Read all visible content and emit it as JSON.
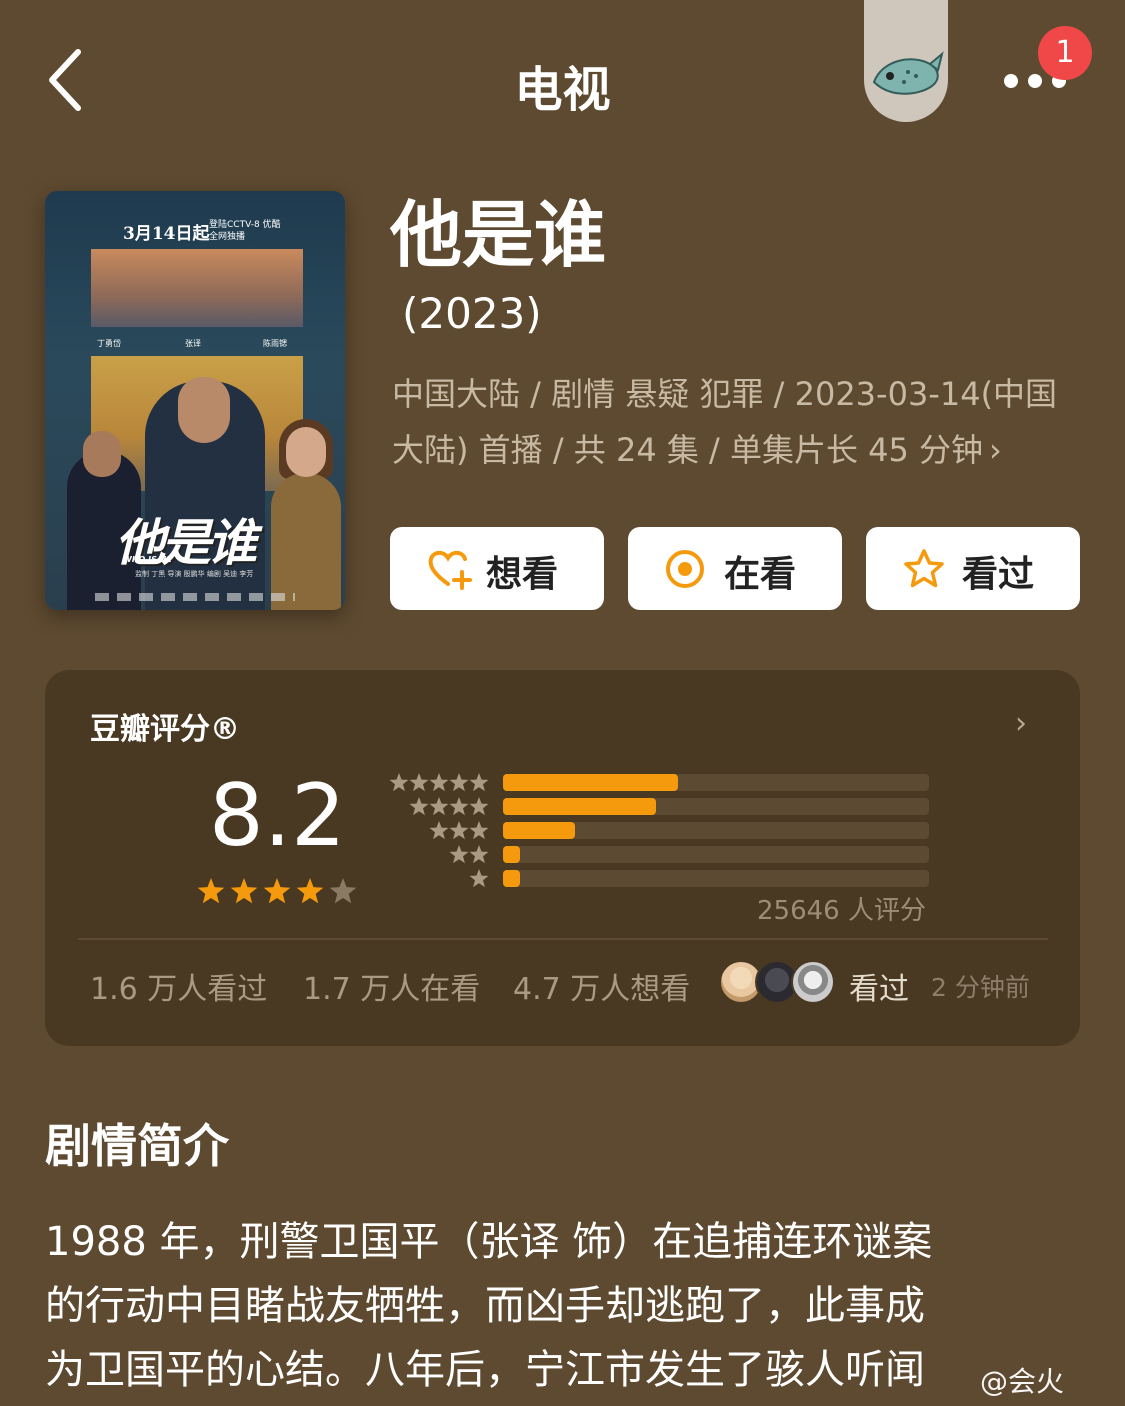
{
  "header": {
    "title": "电视",
    "notification_count": "1"
  },
  "poster": {
    "date_text": "3月14日起",
    "date_sub": "登陆CCTV-8 优酷全网独播",
    "cast": [
      "丁勇岱",
      "张译",
      "陈雨锶"
    ],
    "logo_title": "他是谁",
    "logo_subtitle": "WHO IS HE",
    "credits": "监制 丁黑   导演 殷鹏华   编剧 吴迪 李芳"
  },
  "show": {
    "title": "他是谁",
    "year": "(2023)",
    "meta_line1": "中国大陆 / 剧情 悬疑 犯罪 / 2023-03-14(中国",
    "meta_line2": "大陆) 首播 / 共 24 集 / 单集片长 45 分钟"
  },
  "actions": {
    "want": "想看",
    "watching": "在看",
    "watched": "看过"
  },
  "rating": {
    "label": "豆瓣评分®",
    "score": "8.2",
    "stars_filled": 4,
    "distribution": [
      {
        "stars": 5,
        "fraction": 0.41
      },
      {
        "stars": 4,
        "fraction": 0.36
      },
      {
        "stars": 3,
        "fraction": 0.17
      },
      {
        "stars": 2,
        "fraction": 0.04
      },
      {
        "stars": 1,
        "fraction": 0.04
      }
    ],
    "count_text": "25646 人评分",
    "stats": {
      "watched": "1.6 万人看过",
      "watching": "1.7 万人在看",
      "want": "4.7 万人想看"
    },
    "friends_action": "看过",
    "friends_time": "2 分钟前"
  },
  "synopsis": {
    "heading": "剧情简介",
    "lines": [
      "1988 年，刑警卫国平（张译 饰）在追捕连环谜案",
      "的行动中目睹战友牺牲，而凶手却逃跑了，此事成",
      "为卫国平的心结。八年后，宁江市发生了骇人听闻"
    ]
  },
  "watermark": "@会火",
  "colors": {
    "background": "#5e4a30",
    "card": "#4a3922",
    "accent": "#f59a0c",
    "badge": "#f04848"
  },
  "icons": {
    "back": "chevron-left-icon",
    "mascot": "fish-mascot-icon",
    "more": "ellipsis-icon",
    "want": "heart-plus-icon",
    "watching": "target-circle-icon",
    "watched": "star-outline-icon"
  }
}
